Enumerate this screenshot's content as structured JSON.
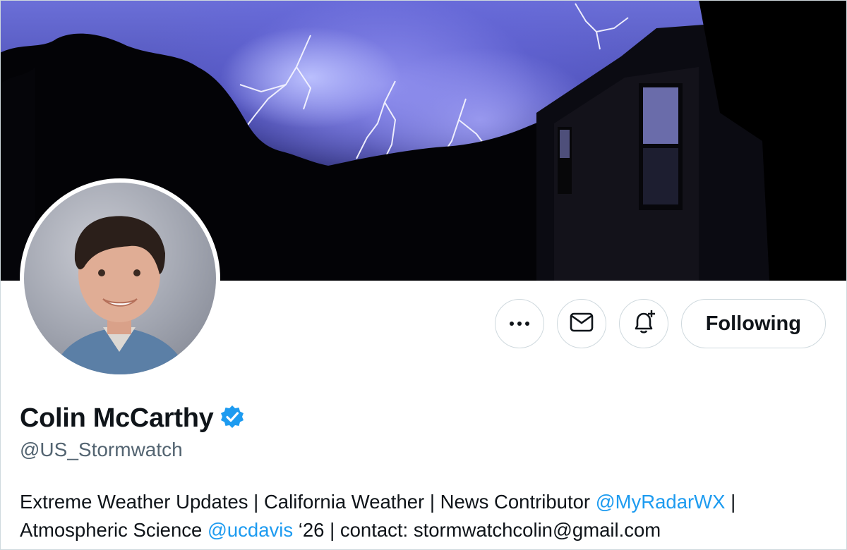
{
  "profile": {
    "display_name": "Colin McCarthy",
    "verified": true,
    "handle": "@US_Stormwatch"
  },
  "actions": {
    "more_icon": "more-dots-icon",
    "message_icon": "envelope-icon",
    "notify_icon": "bell-plus-icon",
    "follow_label": "Following"
  },
  "bio": {
    "line1_part1": "Extreme Weather Updates | California Weather | News Contributor ",
    "line1_mention": "@MyRadarWX",
    "line1_part2": " |",
    "line2_part1": "Atmospheric Science ",
    "line2_mention": "@ucdavis",
    "line2_part2": " ‘26 | contact: stormwatchcolin@gmail.com"
  },
  "colors": {
    "accent": "#1d9bf0",
    "secondary_text": "#536471",
    "border": "#cfd9de"
  }
}
